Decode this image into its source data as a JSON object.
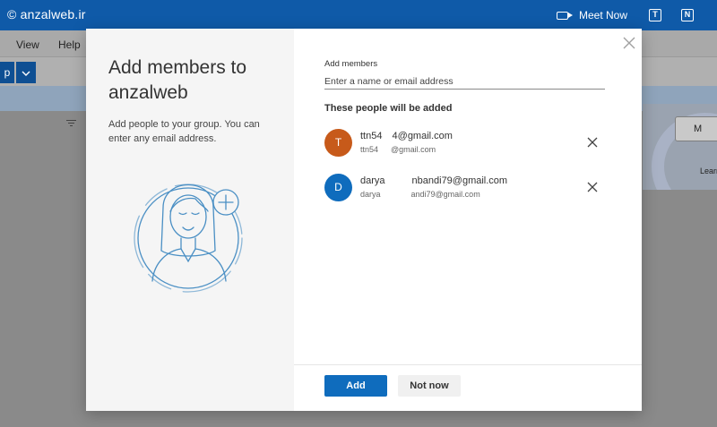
{
  "background": {
    "brand": "© anzalweb.ir",
    "meet_now": "Meet Now",
    "menu": [
      "View",
      "Help"
    ],
    "toolbar_button": "p",
    "card_button": "M",
    "card_learn": "Learn"
  },
  "dialog": {
    "title": "Add members to anzalweb",
    "description": "Add people to your group. You can enter any email address.",
    "add_members_label": "Add members",
    "input_placeholder": "Enter a name or email address",
    "section_title": "These people will be added",
    "members": [
      {
        "initial": "T",
        "name": "ttn54 ",
        "name_rest": "4@gmail.com",
        "email": "ttn54",
        "email_rest": "@gmail.com",
        "color": "#c75a1a"
      },
      {
        "initial": "D",
        "name": "darya",
        "name_rest": "nbandi79@gmail.com",
        "email": "darya",
        "email_rest": "andi79@gmail.com",
        "color": "#0f6cbd"
      }
    ],
    "add_button": "Add",
    "not_now_button": "Not now"
  },
  "colors": {
    "primary": "#0f6cbd",
    "topbar": "#0f5aa8"
  }
}
